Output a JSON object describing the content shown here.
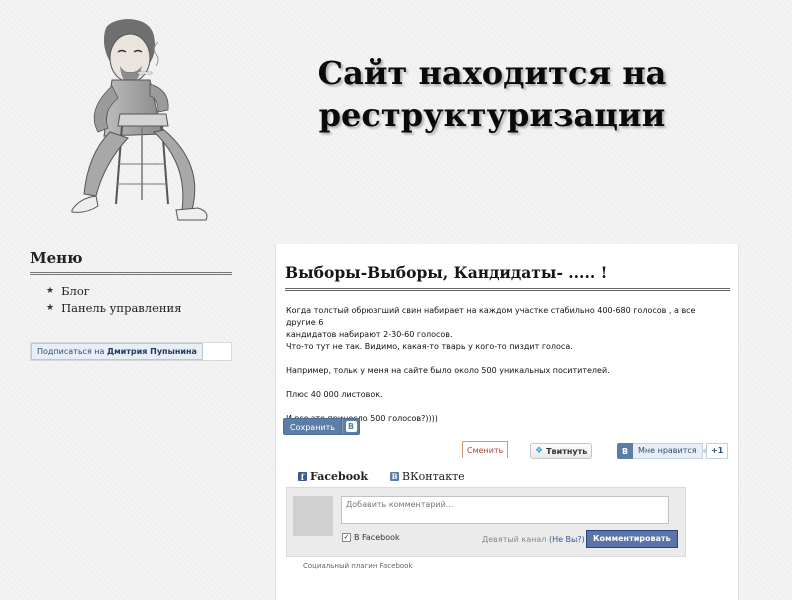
{
  "headline": {
    "line1": "Сайт находится на",
    "line2": "реструктуризации"
  },
  "sidebar": {
    "menu_title": "Меню",
    "items": [
      {
        "label": "Блог"
      },
      {
        "label": "Панель управления"
      }
    ],
    "subscribe": {
      "prefix": "Подписаться на",
      "name": "Дмитрия Пупынина"
    }
  },
  "post": {
    "title": "Выборы-Выборы, Кандидаты- ..... !",
    "lines": [
      "Когда толстый обрюзгший свин набирает на каждом участке стабильно 400-680 голосов , а все другие 6",
      "кандидатов набирают 2-30-60 голосов.",
      "Что-то тут не так. Видимо, какая-то тварь у кого-то пиздит голоса.",
      "Например, тольк у меня на сайте было  около 500 уникальных поситителей.",
      "Плюс 40 000 листовок.",
      "И все это принесло 500 голосов?))))"
    ]
  },
  "share": {
    "save_label": "Сохранить",
    "vk_letter": "B",
    "change_label": "Сменить",
    "tweet_label": "Твитнуть",
    "like_label": "Мне нравится",
    "like_count": "+1"
  },
  "comments": {
    "tab_facebook": "Facebook",
    "tab_vk": "ВКонтакте",
    "placeholder": "Добавить комментарий...",
    "fb_checkbox_label": "В Facebook",
    "channel_text": "Девятый канал",
    "channel_link": "(Не Вы?)",
    "post_button": "Комментировать",
    "plugin_note": "Социальный плагин Facebook"
  },
  "colors": {
    "vk_blue": "#5c7ea6",
    "fb_blue": "#3b5998",
    "fb_button": "#5b74a8"
  }
}
